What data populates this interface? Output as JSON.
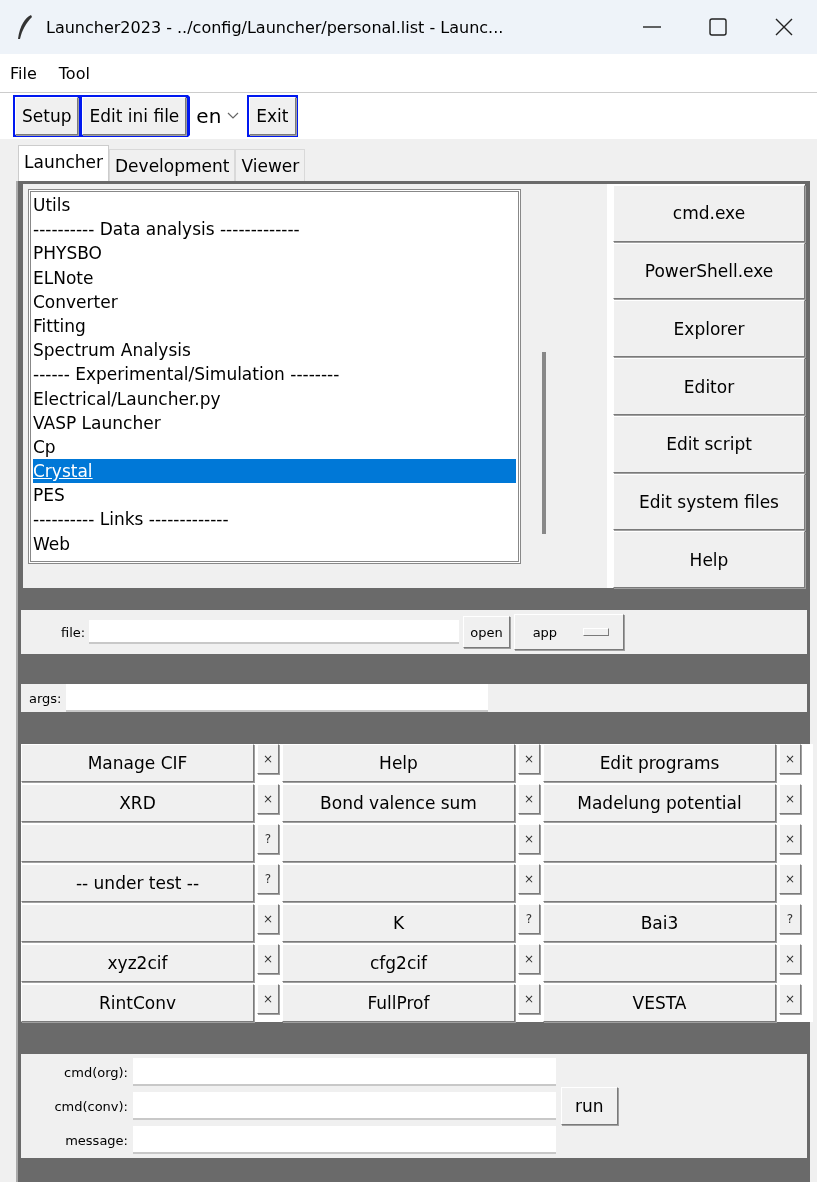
{
  "window": {
    "title": "Launcher2023 - ../config/Launcher/personal.list - Launc..."
  },
  "menu": [
    "File",
    "Tool"
  ],
  "toolbar": {
    "buttons": [
      {
        "label": "Setup",
        "kind": "button"
      },
      {
        "label": "Edit ini file",
        "kind": "button"
      },
      {
        "label": "en",
        "kind": "dropdown"
      },
      {
        "label": "Exit",
        "kind": "button"
      }
    ]
  },
  "tabs": [
    {
      "label": "Launcher",
      "selected": true
    },
    {
      "label": "Development",
      "selected": false
    },
    {
      "label": "Viewer",
      "selected": false
    }
  ],
  "list": {
    "items": [
      {
        "label": "Utils",
        "selected": false
      },
      {
        "label": "---------- Data analysis -------------",
        "selected": false
      },
      {
        "label": "PHYSBO",
        "selected": false
      },
      {
        "label": "ELNote",
        "selected": false
      },
      {
        "label": "Converter",
        "selected": false
      },
      {
        "label": "Fitting",
        "selected": false
      },
      {
        "label": "Spectrum Analysis",
        "selected": false
      },
      {
        "label": "------ Experimental/Simulation --------",
        "selected": false
      },
      {
        "label": "Electrical/Launcher.py",
        "selected": false
      },
      {
        "label": "VASP Launcher",
        "selected": false
      },
      {
        "label": "Cp",
        "selected": false
      },
      {
        "label": "Crystal",
        "selected": true
      },
      {
        "label": "PES",
        "selected": false
      },
      {
        "label": "---------- Links -------------",
        "selected": false
      },
      {
        "label": "Web",
        "selected": false
      }
    ]
  },
  "side_buttons": [
    "cmd.exe",
    "PowerShell.exe",
    "Explorer",
    "Editor",
    "Edit script",
    "Edit system files",
    "Help"
  ],
  "file_row": {
    "label": "file:",
    "button": "open",
    "option": "app"
  },
  "args_row": {
    "label": "args:"
  },
  "grid": [
    [
      {
        "label": "Manage CIF",
        "sign": "×"
      },
      {
        "label": "Help",
        "sign": "×"
      },
      {
        "label": "Edit programs",
        "sign": "×"
      }
    ],
    [
      {
        "label": "XRD",
        "sign": "×"
      },
      {
        "label": "Bond valence sum",
        "sign": "×"
      },
      {
        "label": "Madelung potential",
        "sign": "×"
      }
    ],
    [
      {
        "sign": "?"
      },
      {
        "sign": "×"
      },
      {
        "sign": "×"
      }
    ],
    [
      {
        "label": "-- under test --",
        "sign": "?"
      },
      {
        "sign": "×"
      },
      {
        "sign": "×"
      }
    ],
    [
      {
        "sign": "×"
      },
      {
        "label": "K",
        "sign": "?"
      },
      {
        "label": "Bai3",
        "sign": "?"
      }
    ],
    [
      {
        "label": "xyz2cif",
        "sign": "×"
      },
      {
        "label": "cfg2cif",
        "sign": "×"
      },
      {
        "sign": "×"
      }
    ],
    [
      {
        "label": "RintConv",
        "sign": "×"
      },
      {
        "label": "FullProf",
        "sign": "×"
      },
      {
        "label": "VESTA",
        "sign": "×"
      }
    ]
  ],
  "cmd_panel": {
    "fields": [
      {
        "label": "cmd(org):"
      },
      {
        "label": "cmd(conv):"
      },
      {
        "label": "message:"
      }
    ],
    "button": "run"
  }
}
